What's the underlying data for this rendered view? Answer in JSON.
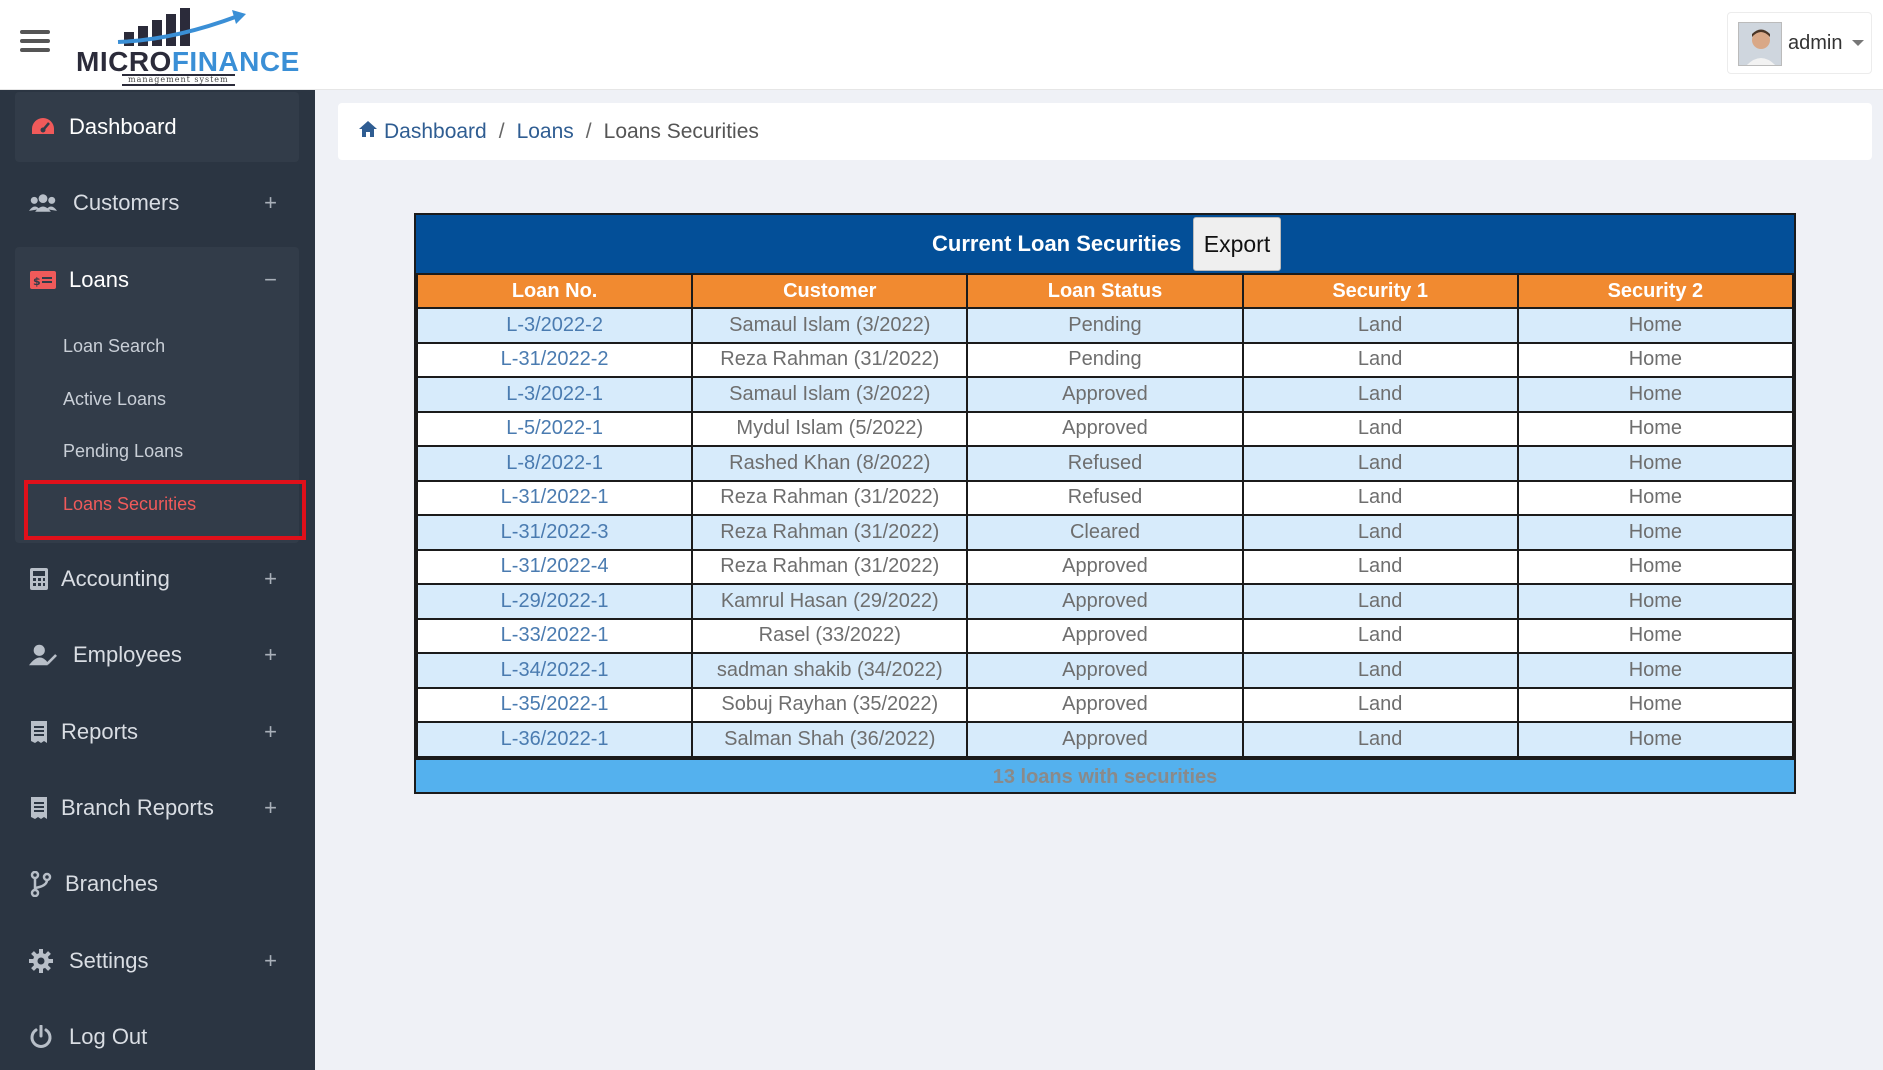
{
  "app": {
    "logo_main": "MICRO",
    "logo_accent": "FINANCE",
    "logo_sub": "management system"
  },
  "user": {
    "name": "admin"
  },
  "sidebar": {
    "items": [
      {
        "label": "Dashboard",
        "icon": "tachometer-icon"
      },
      {
        "label": "Customers",
        "icon": "users-icon"
      },
      {
        "label": "Loans",
        "icon": "money-icon"
      },
      {
        "label": "Accounting",
        "icon": "calculator-icon"
      },
      {
        "label": "Employees",
        "icon": "user-edit-icon"
      },
      {
        "label": "Reports",
        "icon": "receipt-icon"
      },
      {
        "label": "Branch Reports",
        "icon": "receipt-icon"
      },
      {
        "label": "Branches",
        "icon": "code-branch-icon"
      },
      {
        "label": "Settings",
        "icon": "gear-icon"
      },
      {
        "label": "Log Out",
        "icon": "power-icon"
      }
    ],
    "expand_symbol": "+",
    "collapse_symbol": "−",
    "loans_sub": [
      {
        "label": "Loan Search"
      },
      {
        "label": "Active Loans"
      },
      {
        "label": "Pending Loans"
      },
      {
        "label": "Loans Securities"
      }
    ],
    "active_color": "#f05a5a"
  },
  "breadcrumb": {
    "items": [
      "Dashboard",
      "Loans",
      "Loans Securities"
    ],
    "separator": "/"
  },
  "table": {
    "title": "Current Loan Securities",
    "export_label": "Export",
    "columns": [
      "Loan No.",
      "Customer",
      "Loan Status",
      "Security 1",
      "Security 2"
    ],
    "rows": [
      [
        "L-3/2022-2",
        "Samaul Islam (3/2022)",
        "Pending",
        "Land",
        "Home"
      ],
      [
        "L-31/2022-2",
        "Reza Rahman (31/2022)",
        "Pending",
        "Land",
        "Home"
      ],
      [
        "L-3/2022-1",
        "Samaul Islam (3/2022)",
        "Approved",
        "Land",
        "Home"
      ],
      [
        "L-5/2022-1",
        "Mydul Islam (5/2022)",
        "Approved",
        "Land",
        "Home"
      ],
      [
        "L-8/2022-1",
        "Rashed Khan (8/2022)",
        "Refused",
        "Land",
        "Home"
      ],
      [
        "L-31/2022-1",
        "Reza Rahman (31/2022)",
        "Refused",
        "Land",
        "Home"
      ],
      [
        "L-31/2022-3",
        "Reza Rahman (31/2022)",
        "Cleared",
        "Land",
        "Home"
      ],
      [
        "L-31/2022-4",
        "Reza Rahman (31/2022)",
        "Approved",
        "Land",
        "Home"
      ],
      [
        "L-29/2022-1",
        "Kamrul Hasan (29/2022)",
        "Approved",
        "Land",
        "Home"
      ],
      [
        "L-33/2022-1",
        "Rasel (33/2022)",
        "Approved",
        "Land",
        "Home"
      ],
      [
        "L-34/2022-1",
        "sadman shakib (34/2022)",
        "Approved",
        "Land",
        "Home"
      ],
      [
        "L-35/2022-1",
        "Sobuj Rayhan (35/2022)",
        "Approved",
        "Land",
        "Home"
      ],
      [
        "L-36/2022-1",
        "Salman Shah (36/2022)",
        "Approved",
        "Land",
        "Home"
      ]
    ],
    "footer": "13 loans with securities",
    "colors": {
      "header": "#034f98",
      "column_header": "#f18a30",
      "odd_row": "#d7ebfb",
      "footer": "#54b1ee"
    }
  }
}
